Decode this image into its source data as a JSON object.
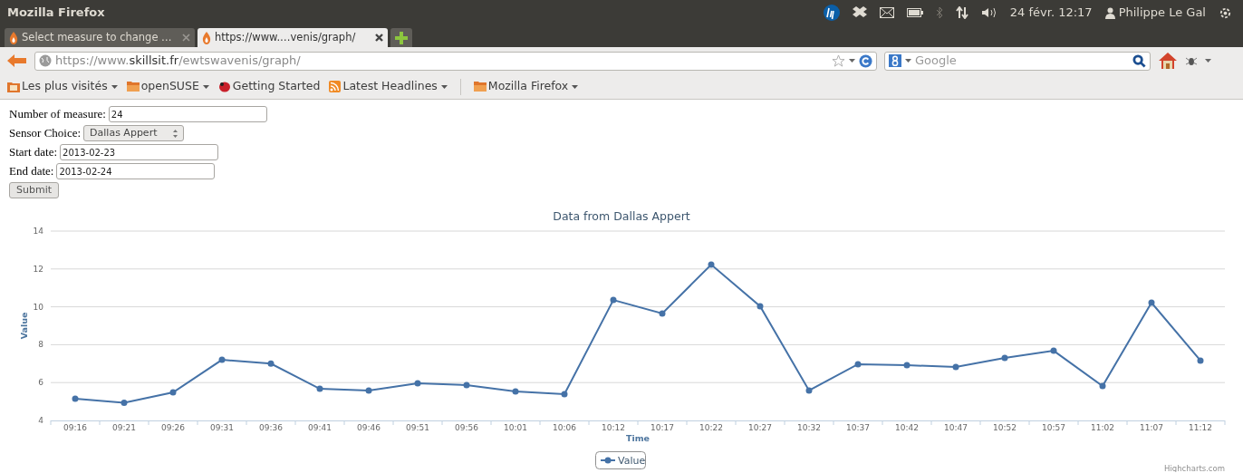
{
  "window": {
    "title": "Mozilla Firefox"
  },
  "panel": {
    "date_time": "24 févr. 12:17",
    "user": "Philippe Le Gal"
  },
  "tabs": [
    {
      "label": "Select measure to change …",
      "selected": false
    },
    {
      "label": "https://www.…venis/graph/",
      "selected": true
    }
  ],
  "url": {
    "prefix": "https://www.",
    "domain": "skillsit.fr",
    "path": "/ewtswavenis/graph/"
  },
  "search": {
    "placeholder": "Google"
  },
  "bookmarks": [
    {
      "label": "Les plus visités",
      "kind": "smart-folder",
      "dropdown": true
    },
    {
      "label": "openSUSE",
      "kind": "folder",
      "dropdown": true
    },
    {
      "label": "Getting Started",
      "kind": "page",
      "dropdown": false
    },
    {
      "label": "Latest Headlines",
      "kind": "feed",
      "dropdown": true
    },
    {
      "label": "Mozilla Firefox",
      "kind": "folder",
      "dropdown": true
    }
  ],
  "form": {
    "fields": [
      {
        "kind": "text",
        "label": "Number of measure:",
        "value": "24"
      },
      {
        "kind": "select",
        "label": "Sensor Choice:",
        "value": "Dallas Appert"
      },
      {
        "kind": "text",
        "label": "Start date:",
        "value": "2013-02-23"
      },
      {
        "kind": "text",
        "label": "End date:",
        "value": "2013-02-24"
      }
    ],
    "submit": "Submit"
  },
  "chart": {
    "credit": "Highcharts.com",
    "chart_data": {
      "type": "line",
      "title": "Data from Dallas Appert",
      "xlabel": "Time",
      "ylabel": "Value",
      "categories": [
        "09:16",
        "09:21",
        "09:26",
        "09:31",
        "09:36",
        "09:41",
        "09:46",
        "09:51",
        "09:56",
        "10:01",
        "10:06",
        "10:12",
        "10:17",
        "10:22",
        "10:27",
        "10:32",
        "10:37",
        "10:42",
        "10:47",
        "10:52",
        "10:57",
        "11:02",
        "11:07",
        "11:12"
      ],
      "series": [
        {
          "name": "Value",
          "color": "#4572a7",
          "marker": true,
          "values": [
            5.15,
            4.93,
            5.48,
            7.2,
            7.0,
            5.67,
            5.58,
            5.96,
            5.87,
            5.53,
            5.39,
            10.36,
            9.65,
            12.23,
            10.03,
            5.58,
            6.97,
            6.92,
            6.82,
            7.3,
            7.68,
            5.82,
            10.22,
            7.16
          ]
        }
      ],
      "ylim": [
        4,
        14
      ],
      "yticks": [
        4,
        6,
        8,
        10,
        12,
        14
      ],
      "grid": true
    }
  }
}
